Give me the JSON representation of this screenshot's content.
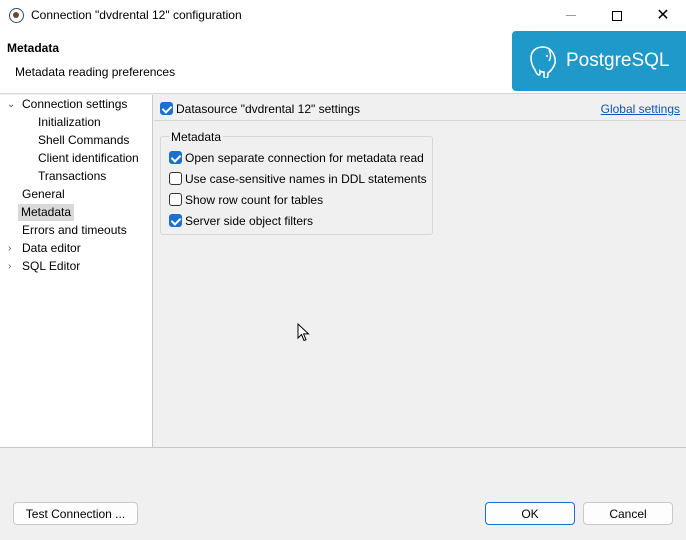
{
  "window": {
    "title": "Connection \"dvdrental 12\" configuration",
    "controls": [
      "minimize-icon",
      "maximize-icon",
      "close-icon"
    ],
    "close_glyph": "✕"
  },
  "header": {
    "title": "Metadata",
    "subtitle": "Metadata reading preferences",
    "logo_text": "PostgreSQL",
    "logo_color": "#1f99c9"
  },
  "tree": {
    "items": [
      {
        "label": "Connection settings",
        "expanded": true
      },
      {
        "label": "Initialization"
      },
      {
        "label": "Shell Commands"
      },
      {
        "label": "Client identification"
      },
      {
        "label": "Transactions"
      },
      {
        "label": "General"
      },
      {
        "label": "Metadata",
        "selected": true
      },
      {
        "label": "Errors and timeouts"
      },
      {
        "label": "Data editor",
        "expanded": false
      },
      {
        "label": "SQL Editor",
        "expanded": false
      }
    ],
    "chevron_open": "⌄",
    "chevron_closed": "›"
  },
  "datasource": {
    "label": "Datasource \"dvdrental 12\" settings",
    "checked": true,
    "global_link": "Global settings"
  },
  "metadata_group": {
    "title": "Metadata",
    "options": [
      {
        "label": "Open separate connection for metadata read",
        "checked": true
      },
      {
        "label": "Use case-sensitive names in DDL statements",
        "checked": false
      },
      {
        "label": "Show row count for tables",
        "checked": false
      },
      {
        "label": "Server side object filters",
        "checked": true
      }
    ]
  },
  "footer": {
    "test_button": "Test Connection ...",
    "ok_button": "OK",
    "cancel_button": "Cancel"
  },
  "colors": {
    "accent": "#1a6fd0",
    "link": "#0b58b6"
  }
}
